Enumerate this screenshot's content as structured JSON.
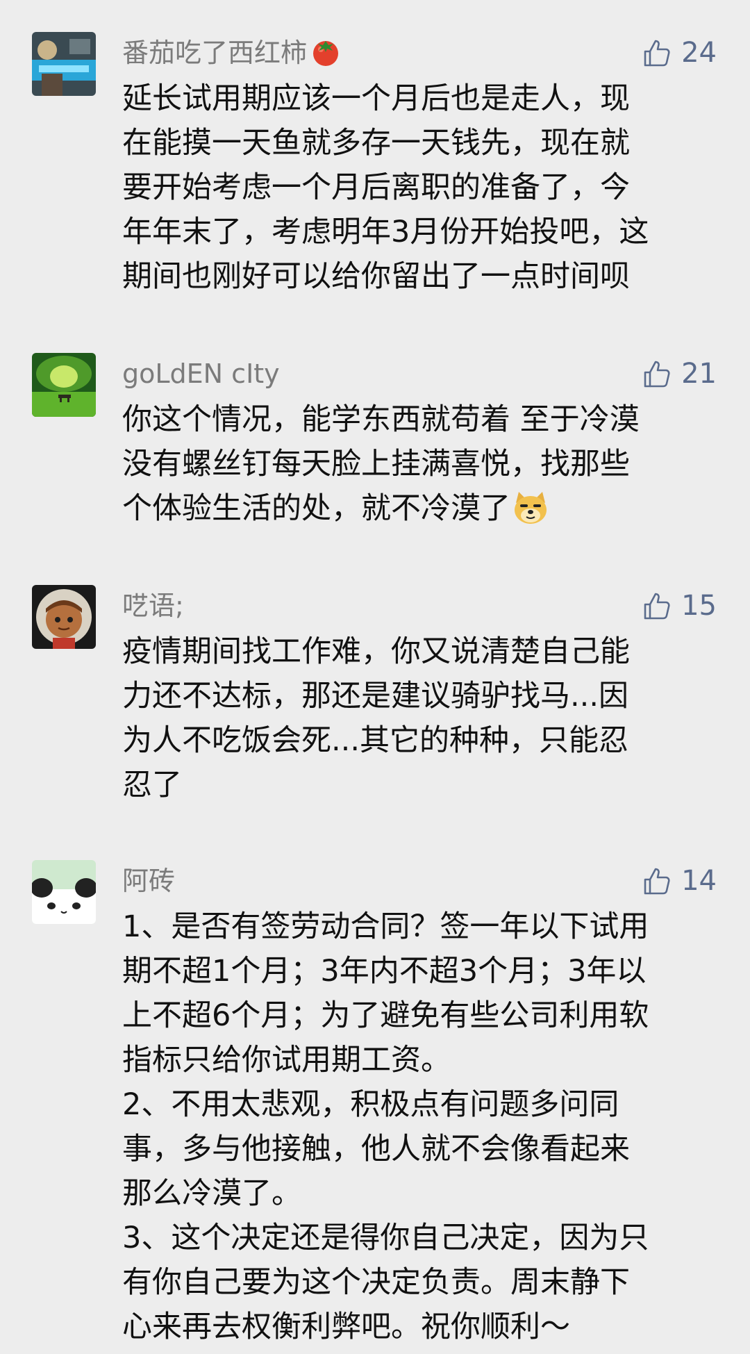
{
  "comments": [
    {
      "name": "番茄吃了西红柿",
      "name_emoji": "tomato-icon",
      "likes": "24",
      "lines": [
        "延长试用期应该一个月后也是走人，现",
        "在能摸一天鱼就多存一天钱先，现在就",
        "要开始考虑一个月后离职的准备了，今",
        "年年末了，考虑明年3月份开始投吧，这",
        "期间也刚好可以给你留出了一点时间呗"
      ]
    },
    {
      "name": "goLdEN cIty",
      "likes": "21",
      "lines": [
        "你这个情况，能学东西就苟着 至于冷漠",
        "没有螺丝钉每天脸上挂满喜悦，找那些",
        "个体验生活的处，就不冷漠了"
      ],
      "trailing_emoji": "doge-icon"
    },
    {
      "name": "呓语;",
      "likes": "15",
      "lines": [
        "疫情期间找工作难，你又说清楚自己能",
        "力还不达标，那还是建议骑驴找马...因",
        "为人不吃饭会死...其它的种种，只能忍",
        "忍了"
      ]
    },
    {
      "name": "阿砖",
      "likes": "14",
      "lines": [
        "1、是否有签劳动合同？签一年以下试用",
        "期不超1个月；3年内不超3个月；3年以",
        "上不超6个月；为了避免有些公司利用软",
        "指标只给你试用期工资。",
        "2、不用太悲观，积极点有问题多问同",
        "事，多与他接触，他人就不会像看起来",
        "那么冷漠了。",
        "3、这个决定还是得你自己决定，因为只",
        "有你自己要为这个决定负责。周末静下",
        "心来再去权衡利弊吧。祝你顺利～"
      ]
    }
  ],
  "colors": {
    "background": "#ededed",
    "name": "#7b7b7b",
    "like": "#5a6b8c",
    "text": "#111111"
  }
}
